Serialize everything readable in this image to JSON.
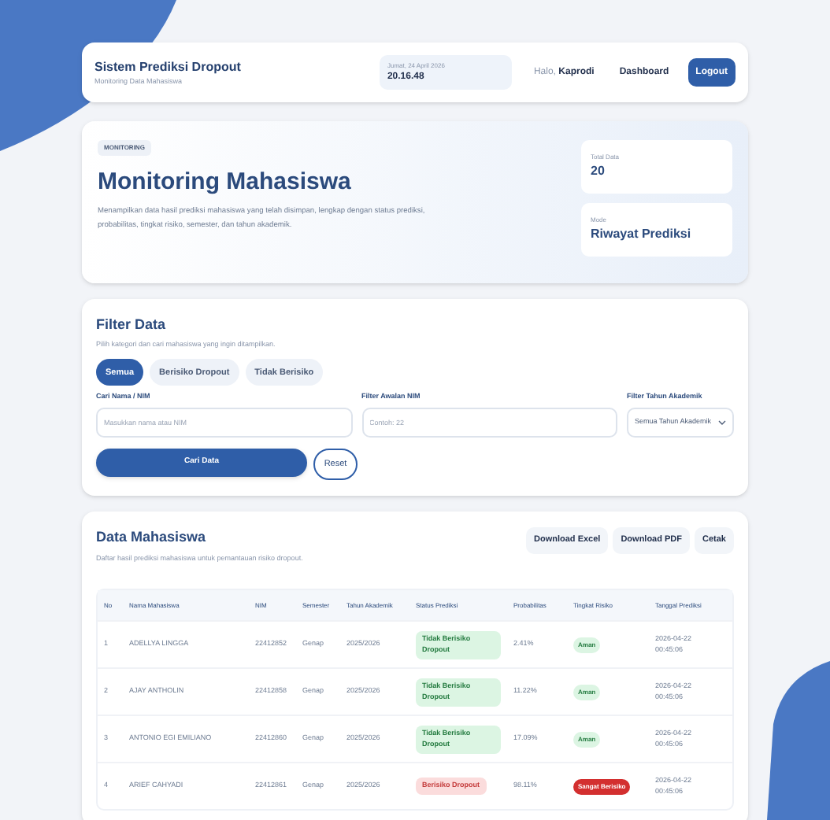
{
  "header": {
    "title": "Sistem Prediksi Dropout",
    "subtitle": "Monitoring Data Mahasiswa",
    "date": "Jumat, 24 April 2026",
    "time": "20.16.48",
    "greeting": "Halo,",
    "user": "Kaprodi",
    "nav": [
      {
        "label": "Dashboard",
        "kind": "link"
      },
      {
        "label": "Logout",
        "kind": "primary"
      }
    ]
  },
  "hero": {
    "badge": "MONITORING",
    "title": "Monitoring Mahasiswa",
    "description": "Menampilkan data hasil prediksi mahasiswa yang telah disimpan, lengkap dengan status prediksi, probabilitas, tingkat risiko, semester, dan tahun akademik.",
    "stats": [
      {
        "label": "Total Data",
        "value": "20"
      },
      {
        "label": "Mode",
        "value": "Riwayat Prediksi"
      }
    ]
  },
  "filter": {
    "title": "Filter Data",
    "subtitle": "Pilih kategori dan cari mahasiswa yang ingin ditampilkan.",
    "tabs": [
      {
        "label": "Semua",
        "selected": true
      },
      {
        "label": "Berisiko Dropout",
        "selected": false
      },
      {
        "label": "Tidak Berisiko",
        "selected": false
      }
    ],
    "fields": [
      {
        "label": "Cari Nama / NIM",
        "placeholder": "Masukkan nama atau NIM",
        "kind": "input"
      },
      {
        "label": "Filter Awalan NIM",
        "placeholder": "Contoh: 22",
        "kind": "input"
      },
      {
        "label": "Filter Tahun Akademik",
        "value": "Semua Tahun Akademik",
        "kind": "select"
      }
    ],
    "buttons": [
      {
        "label": "Cari Data",
        "kind": "primary"
      },
      {
        "label": "Reset",
        "kind": "outline"
      }
    ]
  },
  "data": {
    "title": "Data Mahasiswa",
    "subtitle": "Daftar hasil prediksi mahasiswa untuk pemantauan risiko dropout.",
    "actions": [
      "Download Excel",
      "Download PDF",
      "Cetak"
    ],
    "columns": [
      "No",
      "Nama Mahasiswa",
      "NIM",
      "Semester",
      "Tahun Akademik",
      "Status Prediksi",
      "Probabilitas",
      "Tingkat Risiko",
      "Tanggal Prediksi"
    ],
    "rows": [
      {
        "no": "1",
        "name": "ADELLYA LINGGA",
        "nim": "22412852",
        "semester": "Genap",
        "year": "2025/2026",
        "status": {
          "text": "Tidak Berisiko Dropout",
          "kind": "safe"
        },
        "prob": "2.41%",
        "risk": {
          "text": "Aman",
          "kind": "safe"
        },
        "date": "2026-04-22 00:45:06"
      },
      {
        "no": "2",
        "name": "AJAY ANTHOLIN",
        "nim": "22412858",
        "semester": "Genap",
        "year": "2025/2026",
        "status": {
          "text": "Tidak Berisiko Dropout",
          "kind": "safe"
        },
        "prob": "11.22%",
        "risk": {
          "text": "Aman",
          "kind": "safe"
        },
        "date": "2026-04-22 00:45:06"
      },
      {
        "no": "3",
        "name": "ANTONIO EGI EMILIANO",
        "nim": "22412860",
        "semester": "Genap",
        "year": "2025/2026",
        "status": {
          "text": "Tidak Berisiko Dropout",
          "kind": "safe"
        },
        "prob": "17.09%",
        "risk": {
          "text": "Aman",
          "kind": "safe"
        },
        "date": "2026-04-22 00:45:06"
      },
      {
        "no": "4",
        "name": "ARIEF CAHYADI",
        "nim": "22412861",
        "semester": "Genap",
        "year": "2025/2026",
        "status": {
          "text": "Berisiko Dropout",
          "kind": "risk"
        },
        "prob": "98.11%",
        "risk": {
          "text": "Sangat Berisiko",
          "kind": "high"
        },
        "date": "2026-04-22 00:45:06"
      }
    ]
  }
}
